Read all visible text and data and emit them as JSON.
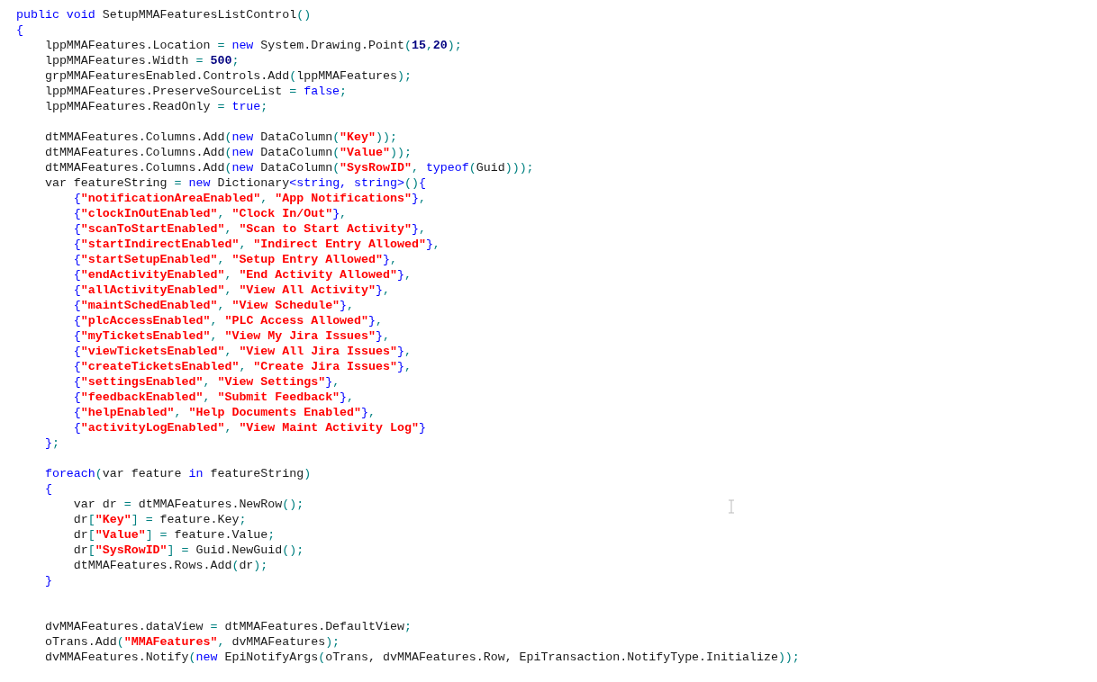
{
  "editor": {
    "blocks": [
      {
        "kind": "top",
        "lines": [
          {
            "tokens": [
              {
                "kind": "keyword",
                "text": "public void"
              },
              {
                "kind": "plain",
                "text": " SetupMMAFeaturesListControl"
              },
              {
                "kind": "punct",
                "text": "()"
              }
            ]
          },
          {
            "tokens": [
              {
                "kind": "keyword",
                "text": "{"
              }
            ]
          },
          {
            "tokens": [
              {
                "kind": "plain",
                "text": "    lppMMAFeatures.Location "
              },
              {
                "kind": "punct",
                "text": "="
              },
              {
                "kind": "keyword",
                "text": " new"
              },
              {
                "kind": "plain",
                "text": " System.Drawing.Point"
              },
              {
                "kind": "punct",
                "text": "("
              },
              {
                "kind": "number",
                "text": "15"
              },
              {
                "kind": "punct",
                "text": ","
              },
              {
                "kind": "number",
                "text": "20"
              },
              {
                "kind": "punct",
                "text": ");"
              }
            ]
          },
          {
            "tokens": [
              {
                "kind": "plain",
                "text": "    lppMMAFeatures.Width "
              },
              {
                "kind": "punct",
                "text": "= "
              },
              {
                "kind": "number",
                "text": "500"
              },
              {
                "kind": "punct",
                "text": ";"
              }
            ]
          },
          {
            "tokens": [
              {
                "kind": "plain",
                "text": "    grpMMAFeaturesEnabled.Controls.Add"
              },
              {
                "kind": "punct",
                "text": "("
              },
              {
                "kind": "plain",
                "text": "lppMMAFeatures"
              },
              {
                "kind": "punct",
                "text": ");"
              }
            ]
          },
          {
            "tokens": [
              {
                "kind": "plain",
                "text": "    lppMMAFeatures.PreserveSourceList "
              },
              {
                "kind": "punct",
                "text": "= "
              },
              {
                "kind": "keyword",
                "text": "false"
              },
              {
                "kind": "punct",
                "text": ";"
              }
            ]
          },
          {
            "tokens": [
              {
                "kind": "plain",
                "text": "    lppMMAFeatures.ReadOnly "
              },
              {
                "kind": "punct",
                "text": "= "
              },
              {
                "kind": "keyword",
                "text": "true"
              },
              {
                "kind": "punct",
                "text": ";"
              }
            ]
          }
        ]
      },
      {
        "kind": "spaced",
        "lines": [
          {
            "tokens": [
              {
                "kind": "plain",
                "text": "    dtMMAFeatures.Columns.Add"
              },
              {
                "kind": "punct",
                "text": "("
              },
              {
                "kind": "keyword",
                "text": "new"
              },
              {
                "kind": "plain",
                "text": " DataColumn"
              },
              {
                "kind": "punct",
                "text": "("
              },
              {
                "kind": "string",
                "text": "\"Key\""
              },
              {
                "kind": "punct",
                "text": "));"
              }
            ]
          },
          {
            "tokens": [
              {
                "kind": "plain",
                "text": "    dtMMAFeatures.Columns.Add"
              },
              {
                "kind": "punct",
                "text": "("
              },
              {
                "kind": "keyword",
                "text": "new"
              },
              {
                "kind": "plain",
                "text": " DataColumn"
              },
              {
                "kind": "punct",
                "text": "("
              },
              {
                "kind": "string",
                "text": "\"Value\""
              },
              {
                "kind": "punct",
                "text": "));"
              }
            ]
          },
          {
            "tokens": [
              {
                "kind": "plain",
                "text": "    dtMMAFeatures.Columns.Add"
              },
              {
                "kind": "punct",
                "text": "("
              },
              {
                "kind": "keyword",
                "text": "new"
              },
              {
                "kind": "plain",
                "text": " DataColumn"
              },
              {
                "kind": "punct",
                "text": "("
              },
              {
                "kind": "string",
                "text": "\"SysRowID\""
              },
              {
                "kind": "punct",
                "text": ", "
              },
              {
                "kind": "keyword",
                "text": "typeof"
              },
              {
                "kind": "punct",
                "text": "("
              },
              {
                "kind": "plain",
                "text": "Guid"
              },
              {
                "kind": "punct",
                "text": ")));"
              }
            ]
          },
          {
            "tokens": [
              {
                "kind": "plain",
                "text": "    var featureString "
              },
              {
                "kind": "punct",
                "text": "= "
              },
              {
                "kind": "keyword",
                "text": "new"
              },
              {
                "kind": "plain",
                "text": " Dictionary"
              },
              {
                "kind": "keyword",
                "text": "<string, string>"
              },
              {
                "kind": "punct",
                "text": "()"
              },
              {
                "kind": "keyword",
                "text": "{"
              }
            ]
          },
          {
            "tokens": [
              {
                "kind": "keyword",
                "text": "        {"
              },
              {
                "kind": "string",
                "text": "\"notificationAreaEnabled\""
              },
              {
                "kind": "punct",
                "text": ", "
              },
              {
                "kind": "string",
                "text": "\"App Notifications\""
              },
              {
                "kind": "keyword",
                "text": "}"
              },
              {
                "kind": "punct",
                "text": ","
              }
            ]
          },
          {
            "tokens": [
              {
                "kind": "keyword",
                "text": "        {"
              },
              {
                "kind": "string",
                "text": "\"clockInOutEnabled\""
              },
              {
                "kind": "punct",
                "text": ", "
              },
              {
                "kind": "string",
                "text": "\"Clock In/Out\""
              },
              {
                "kind": "keyword",
                "text": "}"
              },
              {
                "kind": "punct",
                "text": ","
              }
            ]
          },
          {
            "tokens": [
              {
                "kind": "keyword",
                "text": "        {"
              },
              {
                "kind": "string",
                "text": "\"scanToStartEnabled\""
              },
              {
                "kind": "punct",
                "text": ", "
              },
              {
                "kind": "string",
                "text": "\"Scan to Start Activity\""
              },
              {
                "kind": "keyword",
                "text": "}"
              },
              {
                "kind": "punct",
                "text": ","
              }
            ]
          },
          {
            "tokens": [
              {
                "kind": "keyword",
                "text": "        {"
              },
              {
                "kind": "string",
                "text": "\"startIndirectEnabled\""
              },
              {
                "kind": "punct",
                "text": ", "
              },
              {
                "kind": "string",
                "text": "\"Indirect Entry Allowed\""
              },
              {
                "kind": "keyword",
                "text": "}"
              },
              {
                "kind": "punct",
                "text": ","
              }
            ]
          },
          {
            "tokens": [
              {
                "kind": "keyword",
                "text": "        {"
              },
              {
                "kind": "string",
                "text": "\"startSetupEnabled\""
              },
              {
                "kind": "punct",
                "text": ", "
              },
              {
                "kind": "string",
                "text": "\"Setup Entry Allowed\""
              },
              {
                "kind": "keyword",
                "text": "}"
              },
              {
                "kind": "punct",
                "text": ","
              }
            ]
          },
          {
            "tokens": [
              {
                "kind": "keyword",
                "text": "        {"
              },
              {
                "kind": "string",
                "text": "\"endActivityEnabled\""
              },
              {
                "kind": "punct",
                "text": ", "
              },
              {
                "kind": "string",
                "text": "\"End Activity Allowed\""
              },
              {
                "kind": "keyword",
                "text": "}"
              },
              {
                "kind": "punct",
                "text": ","
              }
            ]
          },
          {
            "tokens": [
              {
                "kind": "keyword",
                "text": "        {"
              },
              {
                "kind": "string",
                "text": "\"allActivityEnabled\""
              },
              {
                "kind": "punct",
                "text": ", "
              },
              {
                "kind": "string",
                "text": "\"View All Activity\""
              },
              {
                "kind": "keyword",
                "text": "}"
              },
              {
                "kind": "punct",
                "text": ","
              }
            ]
          },
          {
            "tokens": [
              {
                "kind": "keyword",
                "text": "        {"
              },
              {
                "kind": "string",
                "text": "\"maintSchedEnabled\""
              },
              {
                "kind": "punct",
                "text": ", "
              },
              {
                "kind": "string",
                "text": "\"View Schedule\""
              },
              {
                "kind": "keyword",
                "text": "}"
              },
              {
                "kind": "punct",
                "text": ","
              }
            ]
          },
          {
            "tokens": [
              {
                "kind": "keyword",
                "text": "        {"
              },
              {
                "kind": "string",
                "text": "\"plcAccessEnabled\""
              },
              {
                "kind": "punct",
                "text": ", "
              },
              {
                "kind": "string",
                "text": "\"PLC Access Allowed\""
              },
              {
                "kind": "keyword",
                "text": "}"
              },
              {
                "kind": "punct",
                "text": ","
              }
            ]
          },
          {
            "tokens": [
              {
                "kind": "keyword",
                "text": "        {"
              },
              {
                "kind": "string",
                "text": "\"myTicketsEnabled\""
              },
              {
                "kind": "punct",
                "text": ", "
              },
              {
                "kind": "string",
                "text": "\"View My Jira Issues\""
              },
              {
                "kind": "keyword",
                "text": "}"
              },
              {
                "kind": "punct",
                "text": ","
              }
            ]
          },
          {
            "tokens": [
              {
                "kind": "keyword",
                "text": "        {"
              },
              {
                "kind": "string",
                "text": "\"viewTicketsEnabled\""
              },
              {
                "kind": "punct",
                "text": ", "
              },
              {
                "kind": "string",
                "text": "\"View All Jira Issues\""
              },
              {
                "kind": "keyword",
                "text": "}"
              },
              {
                "kind": "punct",
                "text": ","
              }
            ]
          },
          {
            "tokens": [
              {
                "kind": "keyword",
                "text": "        {"
              },
              {
                "kind": "string",
                "text": "\"createTicketsEnabled\""
              },
              {
                "kind": "punct",
                "text": ", "
              },
              {
                "kind": "string",
                "text": "\"Create Jira Issues\""
              },
              {
                "kind": "keyword",
                "text": "}"
              },
              {
                "kind": "punct",
                "text": ","
              }
            ]
          },
          {
            "tokens": [
              {
                "kind": "keyword",
                "text": "        {"
              },
              {
                "kind": "string",
                "text": "\"settingsEnabled\""
              },
              {
                "kind": "punct",
                "text": ", "
              },
              {
                "kind": "string",
                "text": "\"View Settings\""
              },
              {
                "kind": "keyword",
                "text": "}"
              },
              {
                "kind": "punct",
                "text": ","
              }
            ]
          },
          {
            "tokens": [
              {
                "kind": "keyword",
                "text": "        {"
              },
              {
                "kind": "string",
                "text": "\"feedbackEnabled\""
              },
              {
                "kind": "punct",
                "text": ", "
              },
              {
                "kind": "string",
                "text": "\"Submit Feedback\""
              },
              {
                "kind": "keyword",
                "text": "}"
              },
              {
                "kind": "punct",
                "text": ","
              }
            ]
          },
          {
            "tokens": [
              {
                "kind": "keyword",
                "text": "        {"
              },
              {
                "kind": "string",
                "text": "\"helpEnabled\""
              },
              {
                "kind": "punct",
                "text": ", "
              },
              {
                "kind": "string",
                "text": "\"Help Documents Enabled\""
              },
              {
                "kind": "keyword",
                "text": "}"
              },
              {
                "kind": "punct",
                "text": ","
              }
            ]
          },
          {
            "tokens": [
              {
                "kind": "keyword",
                "text": "        {"
              },
              {
                "kind": "string",
                "text": "\"activityLogEnabled\""
              },
              {
                "kind": "punct",
                "text": ", "
              },
              {
                "kind": "string",
                "text": "\"View Maint Activity Log\""
              },
              {
                "kind": "keyword",
                "text": "}"
              }
            ]
          },
          {
            "tokens": [
              {
                "kind": "keyword",
                "text": "    }"
              },
              {
                "kind": "punct",
                "text": ";"
              }
            ]
          }
        ]
      },
      {
        "kind": "spaced",
        "lines": [
          {
            "tokens": [
              {
                "kind": "keyword",
                "text": "    foreach"
              },
              {
                "kind": "punct",
                "text": "("
              },
              {
                "kind": "plain",
                "text": "var feature "
              },
              {
                "kind": "keyword",
                "text": "in"
              },
              {
                "kind": "plain",
                "text": " featureString"
              },
              {
                "kind": "punct",
                "text": ")"
              }
            ]
          },
          {
            "tokens": [
              {
                "kind": "keyword",
                "text": "    {"
              }
            ]
          },
          {
            "tokens": [
              {
                "kind": "plain",
                "text": "        var dr "
              },
              {
                "kind": "punct",
                "text": "="
              },
              {
                "kind": "plain",
                "text": " dtMMAFeatures.NewRow"
              },
              {
                "kind": "punct",
                "text": "();"
              }
            ]
          },
          {
            "tokens": [
              {
                "kind": "plain",
                "text": "        dr"
              },
              {
                "kind": "punct",
                "text": "["
              },
              {
                "kind": "string",
                "text": "\"Key\""
              },
              {
                "kind": "punct",
                "text": "] ="
              },
              {
                "kind": "plain",
                "text": " feature.Key"
              },
              {
                "kind": "punct",
                "text": ";"
              }
            ]
          },
          {
            "tokens": [
              {
                "kind": "plain",
                "text": "        dr"
              },
              {
                "kind": "punct",
                "text": "["
              },
              {
                "kind": "string",
                "text": "\"Value\""
              },
              {
                "kind": "punct",
                "text": "] ="
              },
              {
                "kind": "plain",
                "text": " feature.Value"
              },
              {
                "kind": "punct",
                "text": ";"
              }
            ]
          },
          {
            "tokens": [
              {
                "kind": "plain",
                "text": "        dr"
              },
              {
                "kind": "punct",
                "text": "["
              },
              {
                "kind": "string",
                "text": "\"SysRowID\""
              },
              {
                "kind": "punct",
                "text": "] ="
              },
              {
                "kind": "plain",
                "text": " Guid.NewGuid"
              },
              {
                "kind": "punct",
                "text": "();"
              }
            ]
          },
          {
            "tokens": [
              {
                "kind": "plain",
                "text": "        dtMMAFeatures.Rows.Add"
              },
              {
                "kind": "punct",
                "text": "("
              },
              {
                "kind": "plain",
                "text": "dr"
              },
              {
                "kind": "punct",
                "text": ");"
              }
            ]
          },
          {
            "tokens": [
              {
                "kind": "keyword",
                "text": "    }"
              }
            ]
          }
        ]
      },
      {
        "kind": "widespaced",
        "lines": [
          {
            "tokens": [
              {
                "kind": "plain",
                "text": "    dvMMAFeatures.dataView "
              },
              {
                "kind": "punct",
                "text": "="
              },
              {
                "kind": "plain",
                "text": " dtMMAFeatures.DefaultView"
              },
              {
                "kind": "punct",
                "text": ";"
              }
            ]
          },
          {
            "tokens": [
              {
                "kind": "plain",
                "text": "    oTrans.Add"
              },
              {
                "kind": "punct",
                "text": "("
              },
              {
                "kind": "string",
                "text": "\"MMAFeatures\""
              },
              {
                "kind": "punct",
                "text": ", "
              },
              {
                "kind": "plain",
                "text": "dvMMAFeatures"
              },
              {
                "kind": "punct",
                "text": ");"
              }
            ]
          },
          {
            "tokens": [
              {
                "kind": "plain",
                "text": "    dvMMAFeatures.Notify"
              },
              {
                "kind": "punct",
                "text": "("
              },
              {
                "kind": "keyword",
                "text": "new"
              },
              {
                "kind": "plain",
                "text": " EpiNotifyArgs"
              },
              {
                "kind": "punct",
                "text": "("
              },
              {
                "kind": "plain",
                "text": "oTrans, dvMMAFeatures.Row, EpiTransaction.NotifyType.Initialize"
              },
              {
                "kind": "punct",
                "text": "));"
              }
            ]
          }
        ]
      }
    ]
  }
}
